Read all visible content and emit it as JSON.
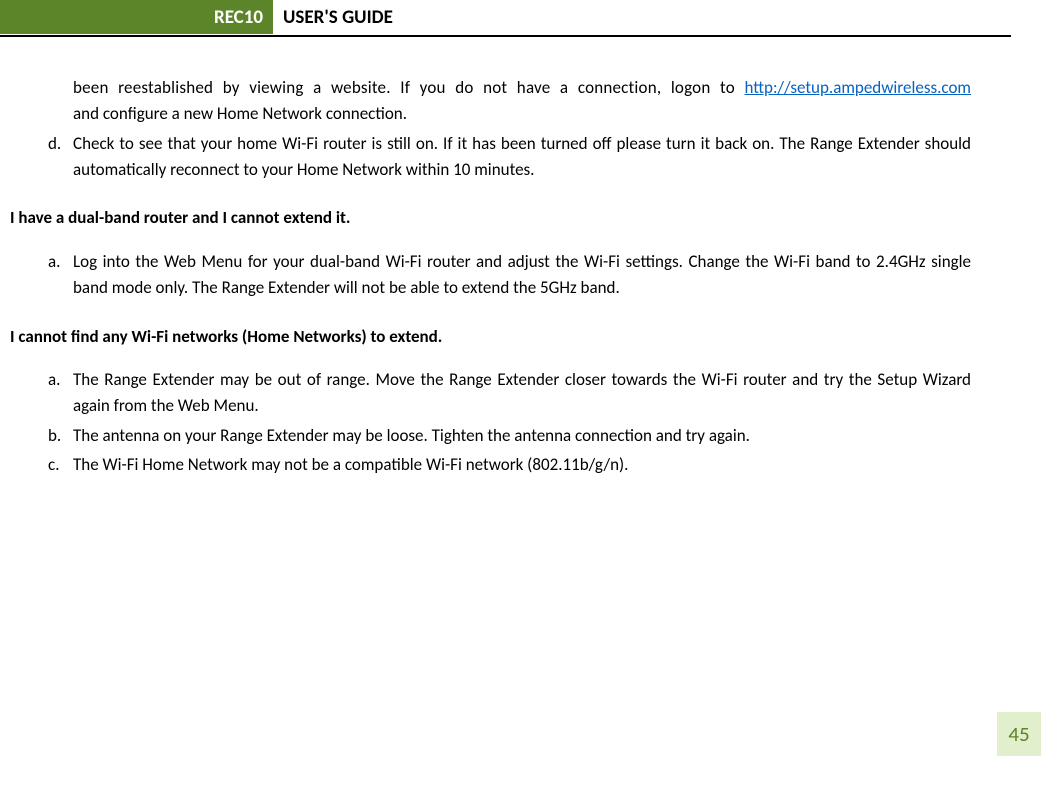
{
  "header": {
    "badge": "REC10",
    "title": "USER'S GUIDE"
  },
  "body": {
    "continued_text_before_link": "been  reestablished  by  viewing  a  website.  If  you  do  not  have  a  connection,  logon  to ",
    "link_text": "http://setup.ampedwireless.com",
    "continued_text_after_link": " and configure a new Home Network connection.",
    "item_d_marker": "d.",
    "item_d_text": "Check to see that your home Wi-Fi router is still on. If it has been turned off please turn it back on.  The Range Extender should automatically reconnect to your Home Network within 10 minutes.",
    "heading1": "I have a dual-band router and I cannot extend it.",
    "sec1_a_marker": "a.",
    "sec1_a_text": "Log into the Web Menu for your dual-band Wi-Fi router and adjust the Wi-Fi settings. Change the Wi-Fi band to 2.4GHz single band mode only. The Range Extender will not be able to extend the 5GHz band.",
    "heading2": "I cannot find any Wi-Fi networks (Home Networks) to extend.",
    "sec2_a_marker": "a.",
    "sec2_a_text": "The Range Extender may be out of range. Move the Range Extender closer towards the Wi-Fi router and try the Setup Wizard again from the Web Menu.",
    "sec2_b_marker": "b.",
    "sec2_b_text": "The antenna on your Range Extender may be loose. Tighten the antenna connection and try again.",
    "sec2_c_marker": "c.",
    "sec2_c_text": "The Wi-Fi Home Network may not be a compatible Wi-Fi network (802.11b/g/n)."
  },
  "page_number": "45"
}
